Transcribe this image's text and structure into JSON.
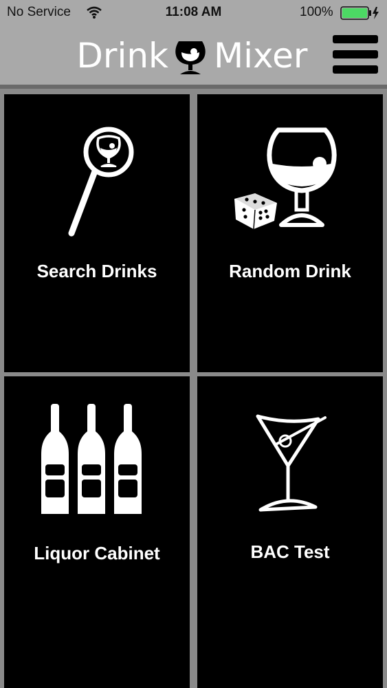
{
  "status_bar": {
    "carrier": "No Service",
    "time": "11:08 AM",
    "battery_percent": "100%"
  },
  "header": {
    "title_left": "Drink",
    "title_right": "Mixer",
    "logo_icon": "brandy-glass-icon",
    "menu_icon": "hamburger-menu-icon"
  },
  "tiles": [
    {
      "label": "Search Drinks",
      "icon": "magnifier-glass-icon"
    },
    {
      "label": "Random Drink",
      "icon": "glass-dice-icon"
    },
    {
      "label": "Liquor Cabinet",
      "icon": "bottles-icon"
    },
    {
      "label": "BAC Test",
      "icon": "martini-icon"
    }
  ],
  "colors": {
    "header_bg": "#a9a9a9",
    "tile_bg": "#000000",
    "grid_bg": "#8a8a8a",
    "battery_fill": "#4cd964"
  }
}
